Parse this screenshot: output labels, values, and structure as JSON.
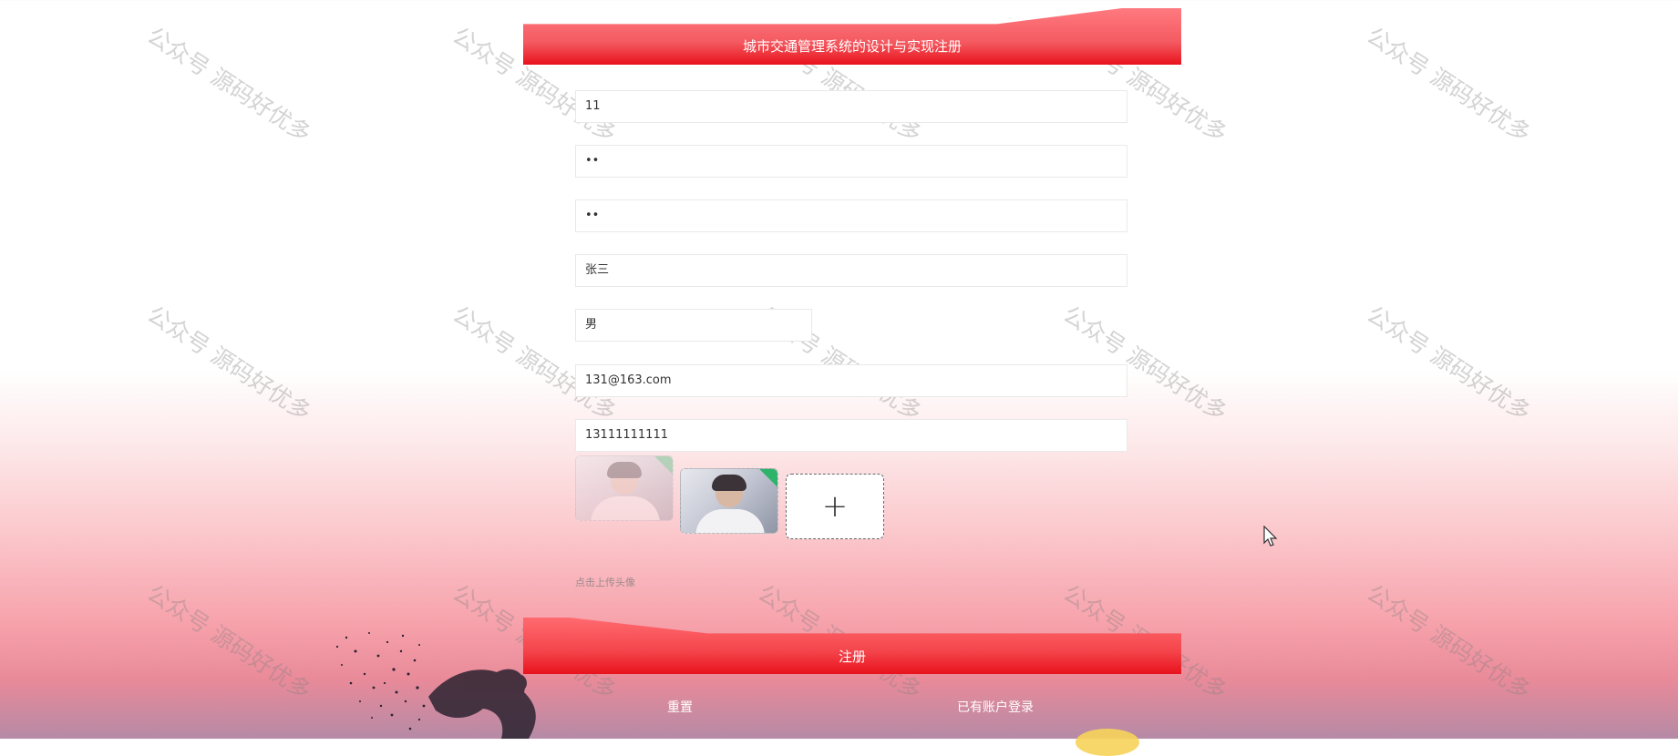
{
  "form": {
    "title": "城市交通管理系统的设计与实现注册",
    "fields": {
      "account": "11",
      "password": "••",
      "confirm_password": "••",
      "name": "张三",
      "gender": "男",
      "email": "131@163.com",
      "phone": "13111111111"
    },
    "upload": {
      "add_symbol": "+",
      "hint": "点击上传头像"
    },
    "submit_label": "注册",
    "reset_label": "重置",
    "login_link_label": "已有账户登录"
  },
  "watermark_text": "公众号 源码好优多",
  "colors": {
    "primary": "#f4444b",
    "primary_dark": "#e8121c"
  }
}
